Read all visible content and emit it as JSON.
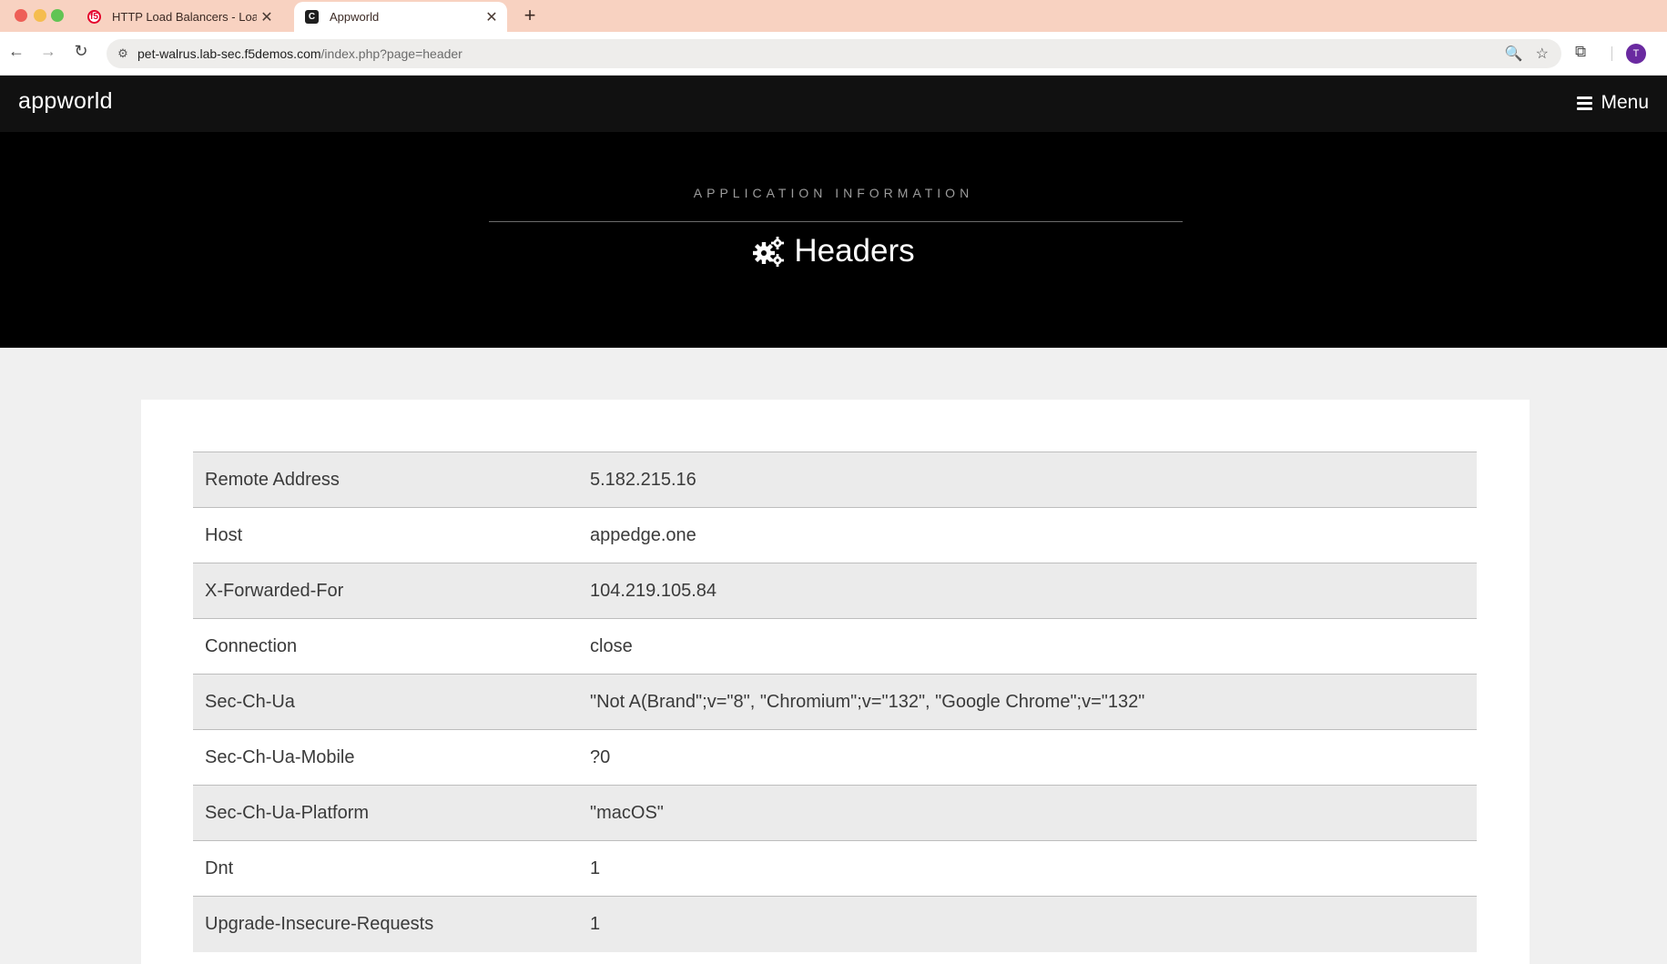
{
  "browser": {
    "tabs": [
      {
        "title": "HTTP Load Balancers - Load",
        "active": false,
        "favicon": "f5-icon"
      },
      {
        "title": "Appworld",
        "active": true,
        "favicon": "appworld-icon"
      }
    ],
    "address": {
      "host": "pet-walrus.lab-sec.f5demos.com",
      "path": "/index.php?page=header"
    },
    "profile_initial": "T"
  },
  "site": {
    "logo": "appworld",
    "menu_label": "Menu"
  },
  "hero": {
    "eyebrow": "APPLICATION INFORMATION",
    "title": "Headers",
    "title_icon": "gears-icon"
  },
  "headers": [
    {
      "name": "Remote Address",
      "value": "5.182.215.16"
    },
    {
      "name": "Host",
      "value": "appedge.one"
    },
    {
      "name": "X-Forwarded-For",
      "value": "104.219.105.84"
    },
    {
      "name": "Connection",
      "value": "close"
    },
    {
      "name": "Sec-Ch-Ua",
      "value": "\"Not A(Brand\";v=\"8\", \"Chromium\";v=\"132\", \"Google Chrome\";v=\"132\""
    },
    {
      "name": "Sec-Ch-Ua-Mobile",
      "value": "?0"
    },
    {
      "name": "Sec-Ch-Ua-Platform",
      "value": "\"macOS\""
    },
    {
      "name": "Dnt",
      "value": "1"
    },
    {
      "name": "Upgrade-Insecure-Requests",
      "value": "1"
    }
  ],
  "colors": {
    "tabbar": "#f8d2c1",
    "nav": "#111111",
    "hero": "#000000",
    "row_alt": "#ebebeb",
    "page_bg": "#f0f0f0"
  }
}
